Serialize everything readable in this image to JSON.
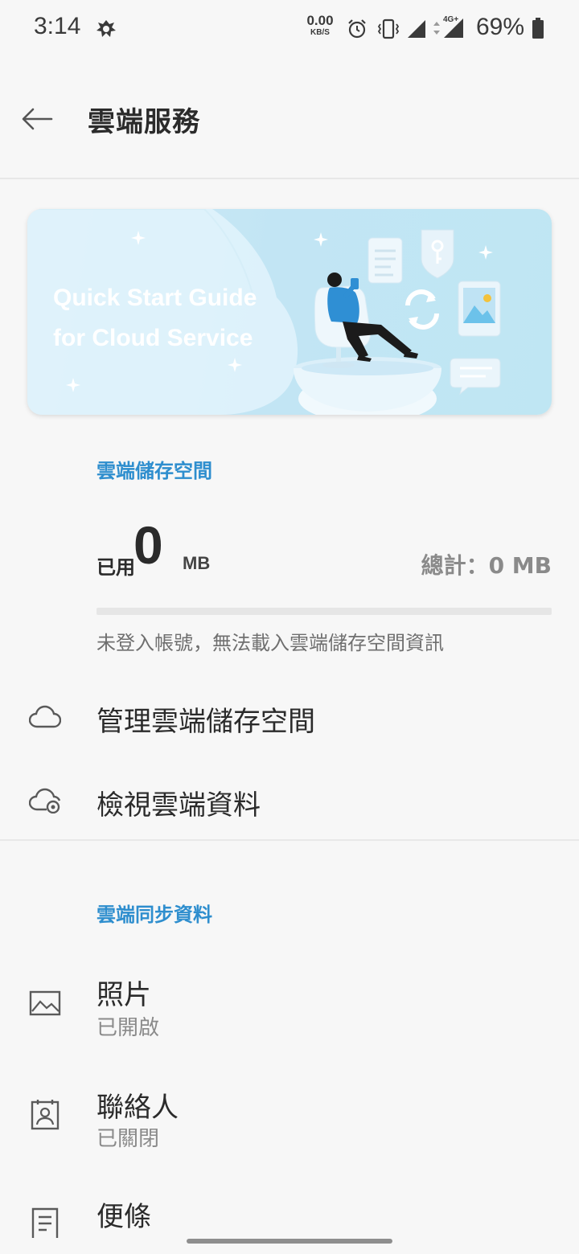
{
  "status_bar": {
    "time": "3:14",
    "net_speed_value": "0.00",
    "net_speed_unit": "KB/S",
    "network_type": "4G+",
    "battery_percent": "69%",
    "icons": [
      "app-notification-icon",
      "alarm-icon",
      "vibrate-icon",
      "signal-icon",
      "signal-icon",
      "battery-icon"
    ]
  },
  "header": {
    "title": "雲端服務",
    "back_icon": "arrow-left-icon"
  },
  "banner": {
    "line1": "Quick Start Guide",
    "line2": "for Cloud Service"
  },
  "storage": {
    "section_title": "雲端儲存空間",
    "used_prefix": "已用",
    "used_value": "0",
    "used_unit": "MB",
    "total": "總計：0 MB",
    "used_fraction": 0,
    "note": "未登入帳號，無法載入雲端儲存空間資訊",
    "actions": [
      {
        "label": "管理雲端儲存空間",
        "icon": "cloud-icon"
      },
      {
        "label": "檢視雲端資料",
        "icon": "cloud-view-icon"
      }
    ]
  },
  "sync": {
    "section_title": "雲端同步資料",
    "items": [
      {
        "label": "照片",
        "status": "已開啟",
        "icon": "photo-icon"
      },
      {
        "label": "聯絡人",
        "status": "已關閉",
        "icon": "contacts-icon"
      },
      {
        "label": "便條",
        "status": "",
        "icon": "notes-icon"
      }
    ]
  },
  "colors": {
    "accent": "#2e8ece",
    "background": "#f7f7f7",
    "text_primary": "#2b2b2b",
    "text_secondary": "#8a8a8a"
  }
}
